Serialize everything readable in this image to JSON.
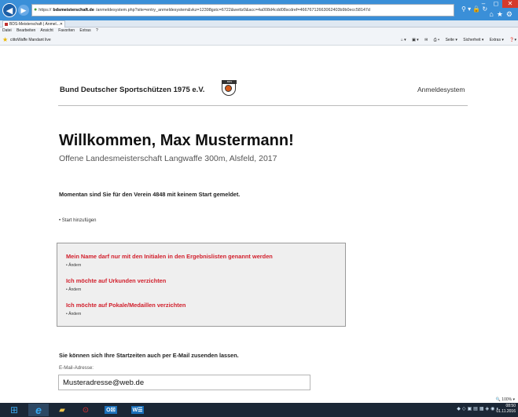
{
  "browser": {
    "url_prefix": "https://",
    "url_host": "bdsmeisterschaft.de",
    "url_path": "/anmeldesystem.php?site=entry_anmeldesystem&vkz=12398gstc=6722&wettz0&acc=4a008d4cdd08scdref=46676712663062403b9b0ecc58147d",
    "tab_title": "BDS-Meisterschaft | Anmel...",
    "menu": [
      "Datei",
      "Bearbeiten",
      "Ansicht",
      "Favoriten",
      "Extras",
      "?"
    ],
    "favorite": "cittoWaffe  Mandant live",
    "toolbar": [
      "Seite ▾",
      "Sicherheit ▾",
      "Extras ▾"
    ],
    "zoom": "100%"
  },
  "header": {
    "site_name": "Bund Deutscher Sportschützen 1975 e.V.",
    "logo_text": "BDS",
    "system_link": "Anmeldesystem"
  },
  "main": {
    "welcome": "Willkommen, Max Mustermann!",
    "event": "Offene Landesmeisterschaft Langwaffe 300m, Alsfeld, 2017",
    "status": "Momentan sind Sie für den Verein 4848 mit keinem Start gemeldet.",
    "add_start": "Start hinzufügen"
  },
  "options": [
    {
      "title": "Mein Name darf nur mit den Initialen in den Ergebnislisten genannt werden",
      "action": "Ändern"
    },
    {
      "title": "Ich möchte auf Urkunden verzichten",
      "action": "Ändern"
    },
    {
      "title": "Ich möchte auf Pokale/Medaillen verzichten",
      "action": "Ändern"
    }
  ],
  "email": {
    "intro": "Sie können sich Ihre Startzeiten auch per E-Mail zusenden lassen.",
    "label": "E-Mail-Adresse:",
    "value": "Musteradresse@web.de"
  },
  "taskbar": {
    "outlook": "O☒",
    "word": "W☰",
    "time": "08:50",
    "date": "01.11.2016"
  },
  "colors": {
    "accent_red": "#d2202d",
    "titlebar_blue": "#3a8fd8",
    "taskbar": "#1b2736"
  }
}
